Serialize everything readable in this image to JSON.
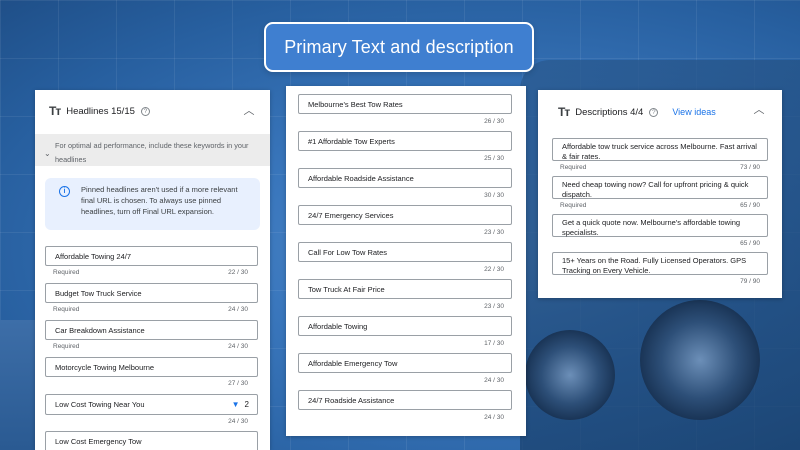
{
  "title": "Primary Text and description",
  "headlines": {
    "title": "Headlines 15/15",
    "keyword_hint": "For optimal ad performance, include these keywords in your headlines",
    "info": "Pinned headlines aren't used if a more relevant final URL is chosen. To always use pinned headlines, turn off Final URL expansion.",
    "fields": [
      {
        "value": "Affordable Towing 24/7",
        "required": "Required",
        "count": "22 / 30"
      },
      {
        "value": "Budget Tow Truck Service",
        "required": "Required",
        "count": "24 / 30"
      },
      {
        "value": "Car Breakdown Assistance",
        "required": "Required",
        "count": "24 / 30"
      },
      {
        "value": "Motorcycle Towing Melbourne",
        "required": "",
        "count": "27 / 30"
      },
      {
        "value": "Low Cost Towing Near You",
        "required": "",
        "count": "24 / 30",
        "pin": "2"
      },
      {
        "value": "Low Cost Emergency Tow",
        "required": "",
        "count": ""
      }
    ]
  },
  "more_headlines": [
    {
      "value": "Melbourne's Best Tow Rates",
      "count": "26 / 30"
    },
    {
      "value": "#1 Affordable Tow Experts",
      "count": "25 / 30"
    },
    {
      "value": "Affordable Roadside Assistance",
      "count": "30 / 30"
    },
    {
      "value": "24/7 Emergency Services",
      "count": "23 / 30"
    },
    {
      "value": "Call For Low Tow Rates",
      "count": "22 / 30"
    },
    {
      "value": "Tow Truck At Fair Price",
      "count": "23 / 30"
    },
    {
      "value": "Affordable Towing",
      "count": "17 / 30"
    },
    {
      "value": "Affordable Emergency Tow",
      "count": "24 / 30"
    },
    {
      "value": "24/7 Roadside Assistance",
      "count": "24 / 30"
    }
  ],
  "descriptions": {
    "title": "Descriptions 4/4",
    "view_ideas": "View ideas",
    "fields": [
      {
        "value": "Affordable tow truck service across Melbourne. Fast arrival & fair rates.",
        "required": "Required",
        "count": "73 / 90"
      },
      {
        "value": "Need cheap towing now? Call for upfront pricing & quick dispatch.",
        "required": "Required",
        "count": "65 / 90"
      },
      {
        "value": "Get a quick quote now. Melbourne's affordable towing specialists.",
        "required": "",
        "count": "65 / 90"
      },
      {
        "value": "15+ Years on the Road. Fully Licensed Operators. GPS Tracking on Every Vehicle.",
        "required": "",
        "count": "79 / 90"
      }
    ]
  },
  "icons": {
    "text": "Tт",
    "help": "?",
    "info": "i",
    "chevron_up": "︿",
    "chevron_down": "⌄",
    "pin": "▼"
  },
  "colors": {
    "accent": "#1a73e8",
    "title_pill": "#3f7fd0"
  }
}
